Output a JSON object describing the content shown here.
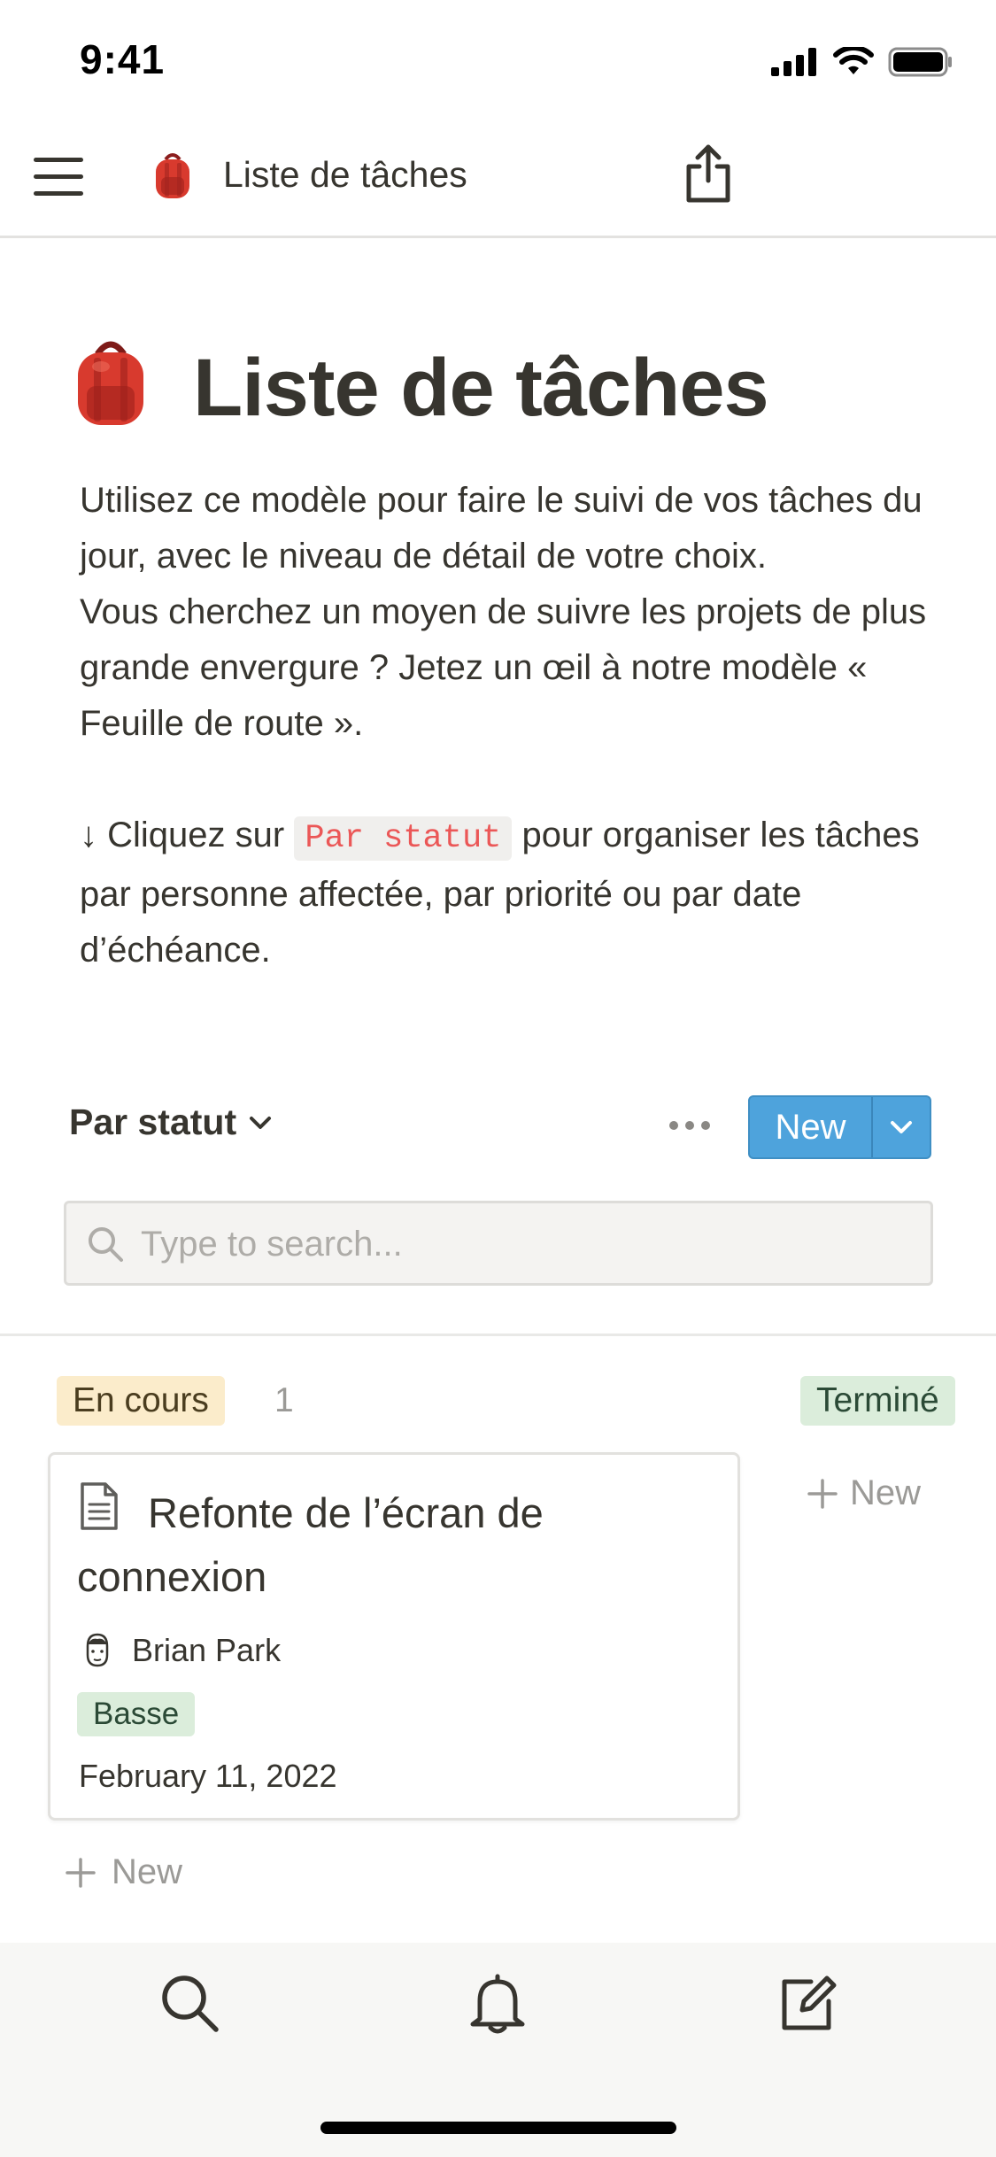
{
  "status_bar": {
    "time": "9:41"
  },
  "nav": {
    "title": "Liste de tâches",
    "icons": [
      "menu-icon",
      "backpack-icon",
      "share-icon"
    ]
  },
  "page": {
    "title": "Liste de tâches",
    "description": {
      "p1": "Utilisez ce modèle pour faire le suivi de vos tâches du jour, avec le niveau de détail de votre choix.",
      "p2": "Vous cherchez un moyen de suivre les projets de plus grande envergure ? Jetez un œil à notre modèle « Feuille de route ».",
      "p3_prefix": "↓ Cliquez sur",
      "p3_code": "Par statut",
      "p3_suffix": "pour organiser les tâches par personne affectée, par priorité ou par date d’échéance."
    }
  },
  "view": {
    "name": "Par statut",
    "new_label": "New",
    "search_placeholder": "Type to search..."
  },
  "board": {
    "columns": [
      {
        "label": "En cours",
        "count": "1",
        "color": "#fbeccb",
        "cards": [
          {
            "title": "Refonte de l’écran de connexion",
            "assignee": "Brian Park",
            "priority": "Basse",
            "date": "February 11, 2022"
          }
        ],
        "new_label": "New"
      },
      {
        "label": "Terminé",
        "color": "#dbeddb",
        "new_label": "New"
      }
    ]
  },
  "tabbar": {
    "icons": [
      "search-icon",
      "bell-icon",
      "compose-icon"
    ]
  },
  "colors": {
    "accent": "#4ea3dc",
    "text": "#37352f",
    "code_text": "#eb5757"
  }
}
